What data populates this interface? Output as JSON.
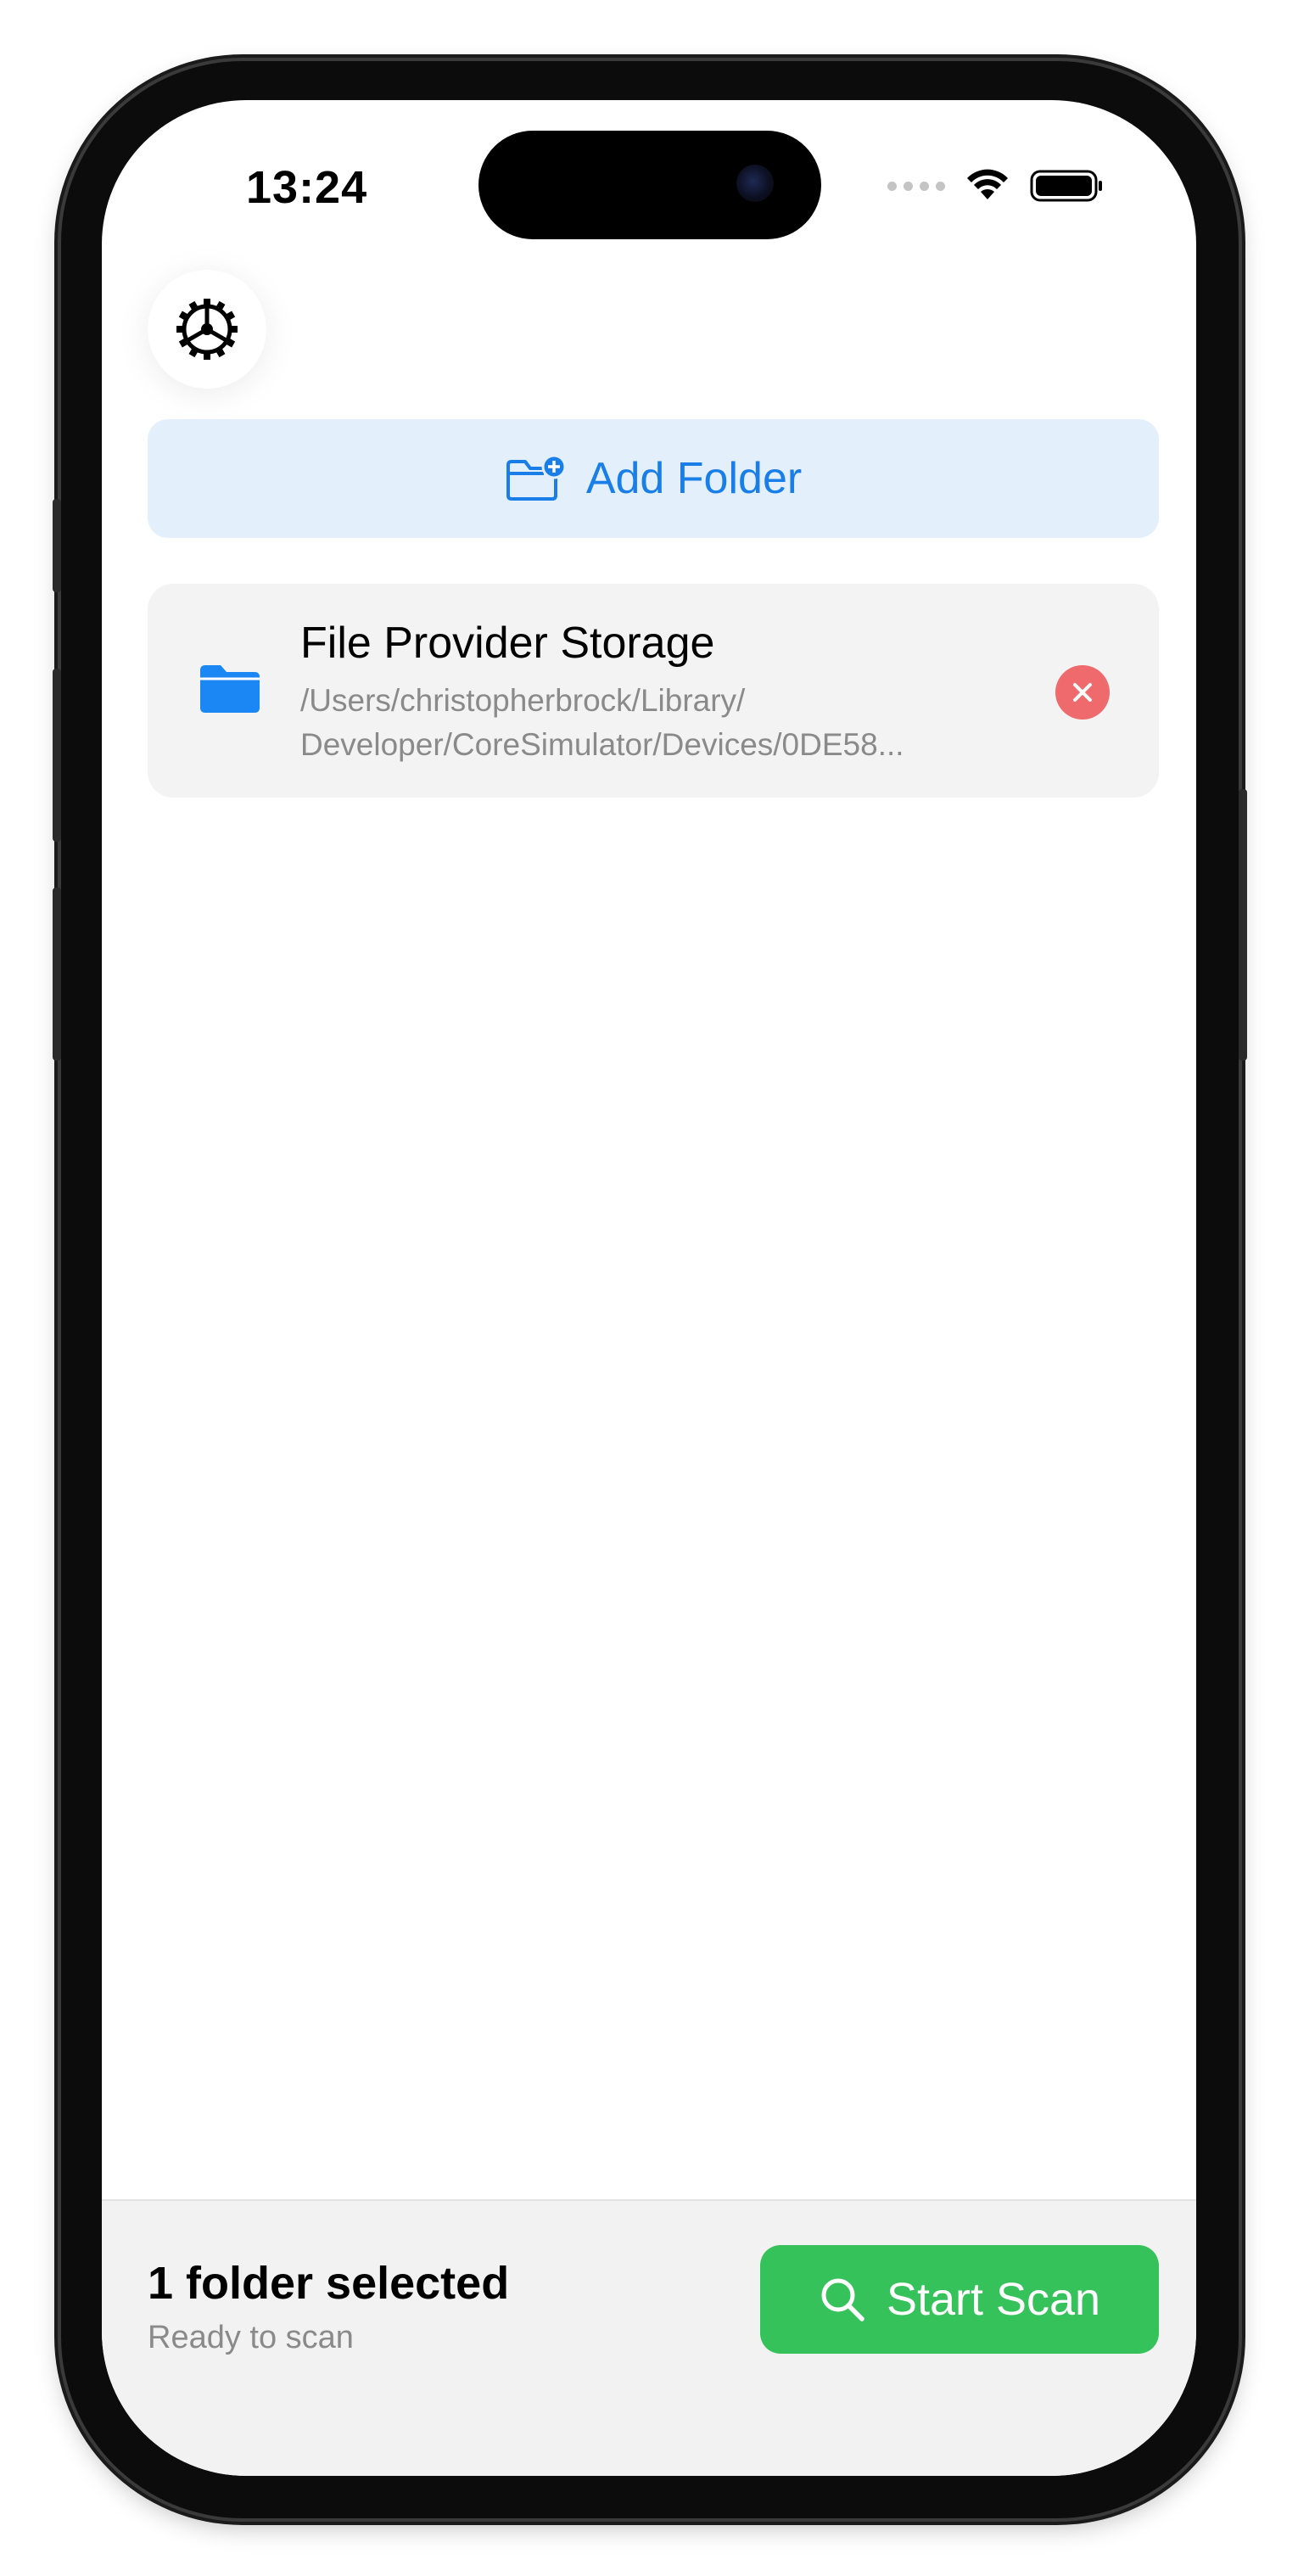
{
  "status_bar": {
    "time": "13:24"
  },
  "toolbar": {
    "settings_icon": "gear-icon"
  },
  "add_folder": {
    "label": "Add Folder",
    "icon": "folder-plus-icon"
  },
  "folders": [
    {
      "name": "File Provider Storage",
      "path": "/Users/christopherbrock/Library/ Developer/CoreSimulator/Devices/0DE58...",
      "icon": "folder-icon",
      "remove_icon": "close-circle-icon"
    }
  ],
  "footer": {
    "selected_count": "1 folder selected",
    "status": "Ready to scan",
    "scan_button_label": "Start Scan",
    "scan_icon": "search-icon"
  },
  "colors": {
    "accent_blue": "#1a7ee8",
    "add_folder_bg": "#e3effb",
    "scan_green": "#36c25a",
    "remove_red": "#ef6a6c",
    "card_bg": "#f3f3f3"
  }
}
